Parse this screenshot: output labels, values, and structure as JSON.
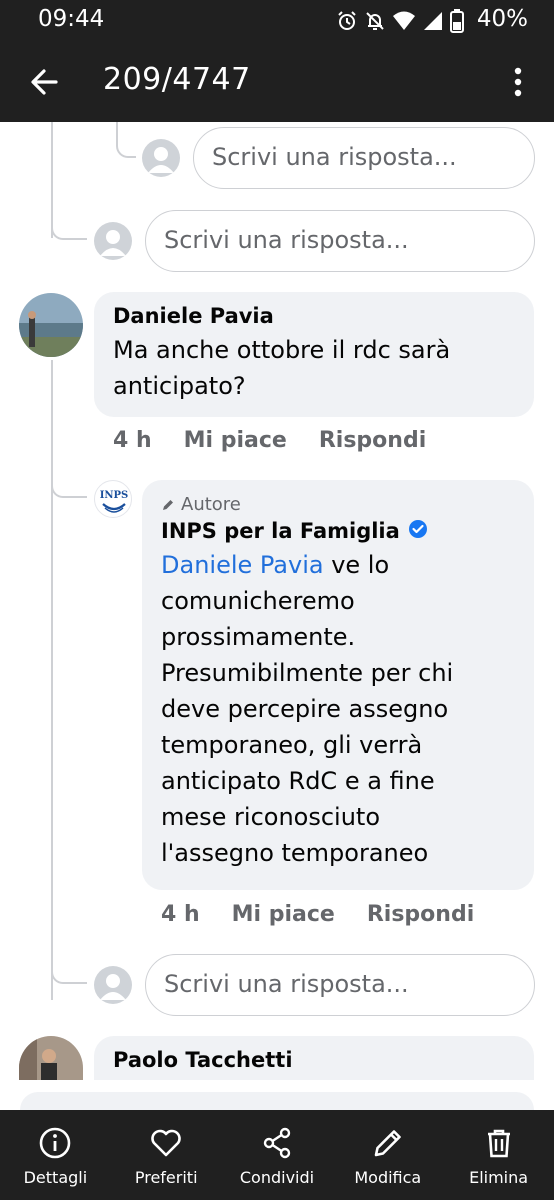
{
  "status_bar": {
    "time": "09:44",
    "battery_percent": "40%",
    "icons": [
      "alarm-icon",
      "mute-icon",
      "wifi-icon",
      "signal-icon",
      "battery-icon"
    ]
  },
  "app_bar": {
    "title": "209/4747",
    "back_icon": "arrow-left-icon",
    "more_icon": "more-vertical-icon"
  },
  "replies": {
    "placeholder": "Scrivi una risposta..."
  },
  "comments": [
    {
      "author": "Daniele Pavia",
      "text": "Ma anche ottobre il rdc sarà anticipato?",
      "time": "4 h",
      "like_label": "Mi piace",
      "reply_label": "Rispondi"
    },
    {
      "author_tag": "Autore",
      "author": "INPS per la Famiglia",
      "verified": true,
      "mention": "Daniele Pavia",
      "text_lines": [
        " ve lo",
        "comunicheremo",
        "prossimamente.",
        "Presumibilmente per chi",
        "deve percepire assegno",
        "temporaneo, gli verrà",
        "anticipato RdC e a fine",
        "mese riconosciuto",
        "l'assegno temporaneo"
      ],
      "time": "4 h",
      "like_label": "Mi piace",
      "reply_label": "Rispondi",
      "logo_text": "INPS"
    },
    {
      "author": "Paolo Tacchetti"
    }
  ],
  "toolbar": {
    "items": [
      {
        "label": "Dettagli",
        "icon": "info-icon"
      },
      {
        "label": "Preferiti",
        "icon": "heart-icon"
      },
      {
        "label": "Condividi",
        "icon": "share-icon"
      },
      {
        "label": "Modifica",
        "icon": "pencil-icon"
      },
      {
        "label": "Elimina",
        "icon": "trash-icon"
      }
    ]
  },
  "colors": {
    "bar_background": "#202020",
    "bubble_background": "#f0f2f5",
    "mention_blue": "#216fdb",
    "verified_blue": "#1877f2",
    "meta_gray": "#65676b"
  }
}
